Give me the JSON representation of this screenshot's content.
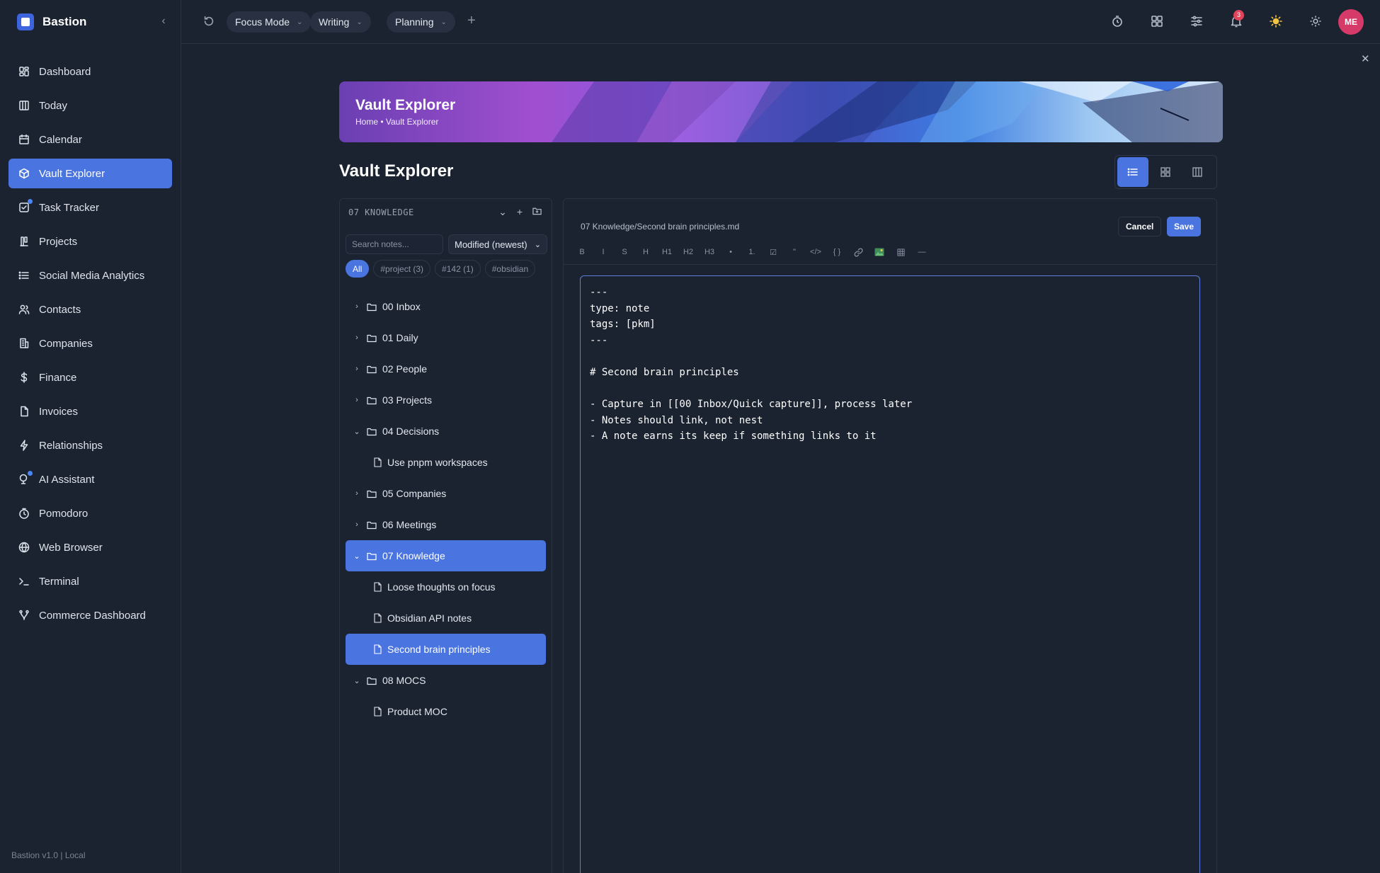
{
  "app": {
    "name": "Bastion",
    "footer": "Bastion v1.0 | Local",
    "collapse_icon": "chevron-left-icon"
  },
  "sidebar": {
    "items": [
      {
        "label": "Dashboard",
        "icon": "dashboard-icon",
        "active": false
      },
      {
        "label": "Today",
        "icon": "columns-icon",
        "active": false
      },
      {
        "label": "Calendar",
        "icon": "calendar-icon",
        "active": false
      },
      {
        "label": "Vault Explorer",
        "icon": "cube-icon",
        "active": true
      },
      {
        "label": "Task Tracker",
        "icon": "checkbox-icon",
        "active": false,
        "dot": true
      },
      {
        "label": "Projects",
        "icon": "projects-icon",
        "active": false
      },
      {
        "label": "Social Media Analytics",
        "icon": "list-icon",
        "active": false
      },
      {
        "label": "Contacts",
        "icon": "users-icon",
        "active": false
      },
      {
        "label": "Companies",
        "icon": "building-icon",
        "active": false
      },
      {
        "label": "Finance",
        "icon": "dollar-icon",
        "active": false
      },
      {
        "label": "Invoices",
        "icon": "document-icon",
        "active": false
      },
      {
        "label": "Relationships",
        "icon": "lightning-icon",
        "active": false
      },
      {
        "label": "AI Assistant",
        "icon": "bot-icon",
        "active": false,
        "dot": true
      },
      {
        "label": "Pomodoro",
        "icon": "timer-icon",
        "active": false
      },
      {
        "label": "Web Browser",
        "icon": "globe-icon",
        "active": false
      },
      {
        "label": "Terminal",
        "icon": "terminal-icon",
        "active": false
      },
      {
        "label": "Commerce Dashboard",
        "icon": "branch-icon",
        "active": false
      }
    ]
  },
  "topbar": {
    "tabs": [
      {
        "label": "Focus Mode"
      },
      {
        "label": "Writing"
      },
      {
        "label": "Planning"
      }
    ],
    "notification_count": "3",
    "avatar_initials": "ME",
    "accent": "#4a74e0"
  },
  "banner": {
    "title": "Vault Explorer",
    "breadcrumb": "Home • Vault Explorer"
  },
  "page": {
    "title": "Vault Explorer"
  },
  "explorer": {
    "header": "07 KNOWLEDGE",
    "search_placeholder": "Search notes...",
    "sort_label": "Modified (newest)",
    "tags": [
      {
        "label": "All",
        "active": true
      },
      {
        "label": "#project (3)",
        "active": false
      },
      {
        "label": "#142 (1)",
        "active": false
      },
      {
        "label": "#obsidian",
        "active": false
      }
    ],
    "tree": [
      {
        "type": "folder",
        "label": "00 Inbox",
        "expanded": false,
        "selected": false
      },
      {
        "type": "folder",
        "label": "01 Daily",
        "expanded": false,
        "selected": false
      },
      {
        "type": "folder",
        "label": "02 People",
        "expanded": false,
        "selected": false
      },
      {
        "type": "folder",
        "label": "03 Projects",
        "expanded": false,
        "selected": false
      },
      {
        "type": "folder",
        "label": "04 Decisions",
        "expanded": true,
        "selected": false
      },
      {
        "type": "file",
        "label": "Use pnpm workspaces",
        "selected": false
      },
      {
        "type": "folder",
        "label": "05 Companies",
        "expanded": false,
        "selected": false
      },
      {
        "type": "folder",
        "label": "06 Meetings",
        "expanded": false,
        "selected": false
      },
      {
        "type": "folder",
        "label": "07 Knowledge",
        "expanded": true,
        "selected": true
      },
      {
        "type": "file",
        "label": "Loose thoughts on focus",
        "selected": false
      },
      {
        "type": "file",
        "label": "Obsidian API notes",
        "selected": false
      },
      {
        "type": "file",
        "label": "Second brain principles",
        "selected": true
      },
      {
        "type": "folder",
        "label": "08 MOCS",
        "expanded": true,
        "selected": false
      },
      {
        "type": "file",
        "label": "Product MOC",
        "selected": false
      }
    ]
  },
  "editor": {
    "path": "07 Knowledge/Second brain principles.md",
    "cancel_label": "Cancel",
    "save_label": "Save",
    "toolbar": [
      "B",
      "I",
      "S",
      "H",
      "H1",
      "H2",
      "H3",
      "•",
      "1.",
      "☑",
      "\"",
      "</>",
      "{ }",
      "link-icon",
      "image-icon",
      "table-icon",
      "—"
    ],
    "content": "---\ntype: note\ntags: [pkm]\n---\n\n# Second brain principles\n\n- Capture in [[00 Inbox/Quick capture]], process later\n- Notes should link, not nest\n- A note earns its keep if something links to it"
  }
}
